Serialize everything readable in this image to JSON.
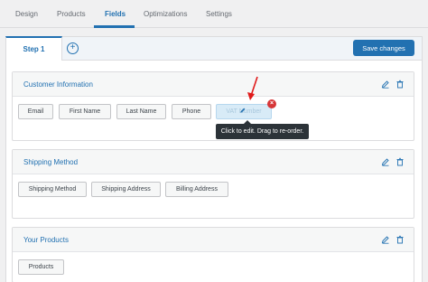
{
  "nav": {
    "tabs": [
      "Design",
      "Products",
      "Fields",
      "Optimizations",
      "Settings"
    ],
    "active": "Fields"
  },
  "steps": {
    "current": "Step 1",
    "save_label": "Save changes"
  },
  "sections": [
    {
      "title": "Customer Information",
      "fields": [
        "Email",
        "First Name",
        "Last Name",
        "Phone"
      ],
      "hovered_field_label": "VAT Number"
    },
    {
      "title": "Shipping Method",
      "fields": [
        "Shipping Method",
        "Shipping Address",
        "Billing Address"
      ]
    },
    {
      "title": "Your Products",
      "fields": [
        "Products"
      ]
    }
  ],
  "tooltip": "Click to edit. Drag to re-order.",
  "icons": {
    "add_step": "plus-circle-icon",
    "edit": "pencil-icon",
    "delete": "trash-icon",
    "remove": "close-icon",
    "pointer": "red-arrow-icon"
  },
  "colors": {
    "accent": "#2271b1",
    "danger": "#d63638",
    "tooltip_bg": "#2c3338"
  }
}
